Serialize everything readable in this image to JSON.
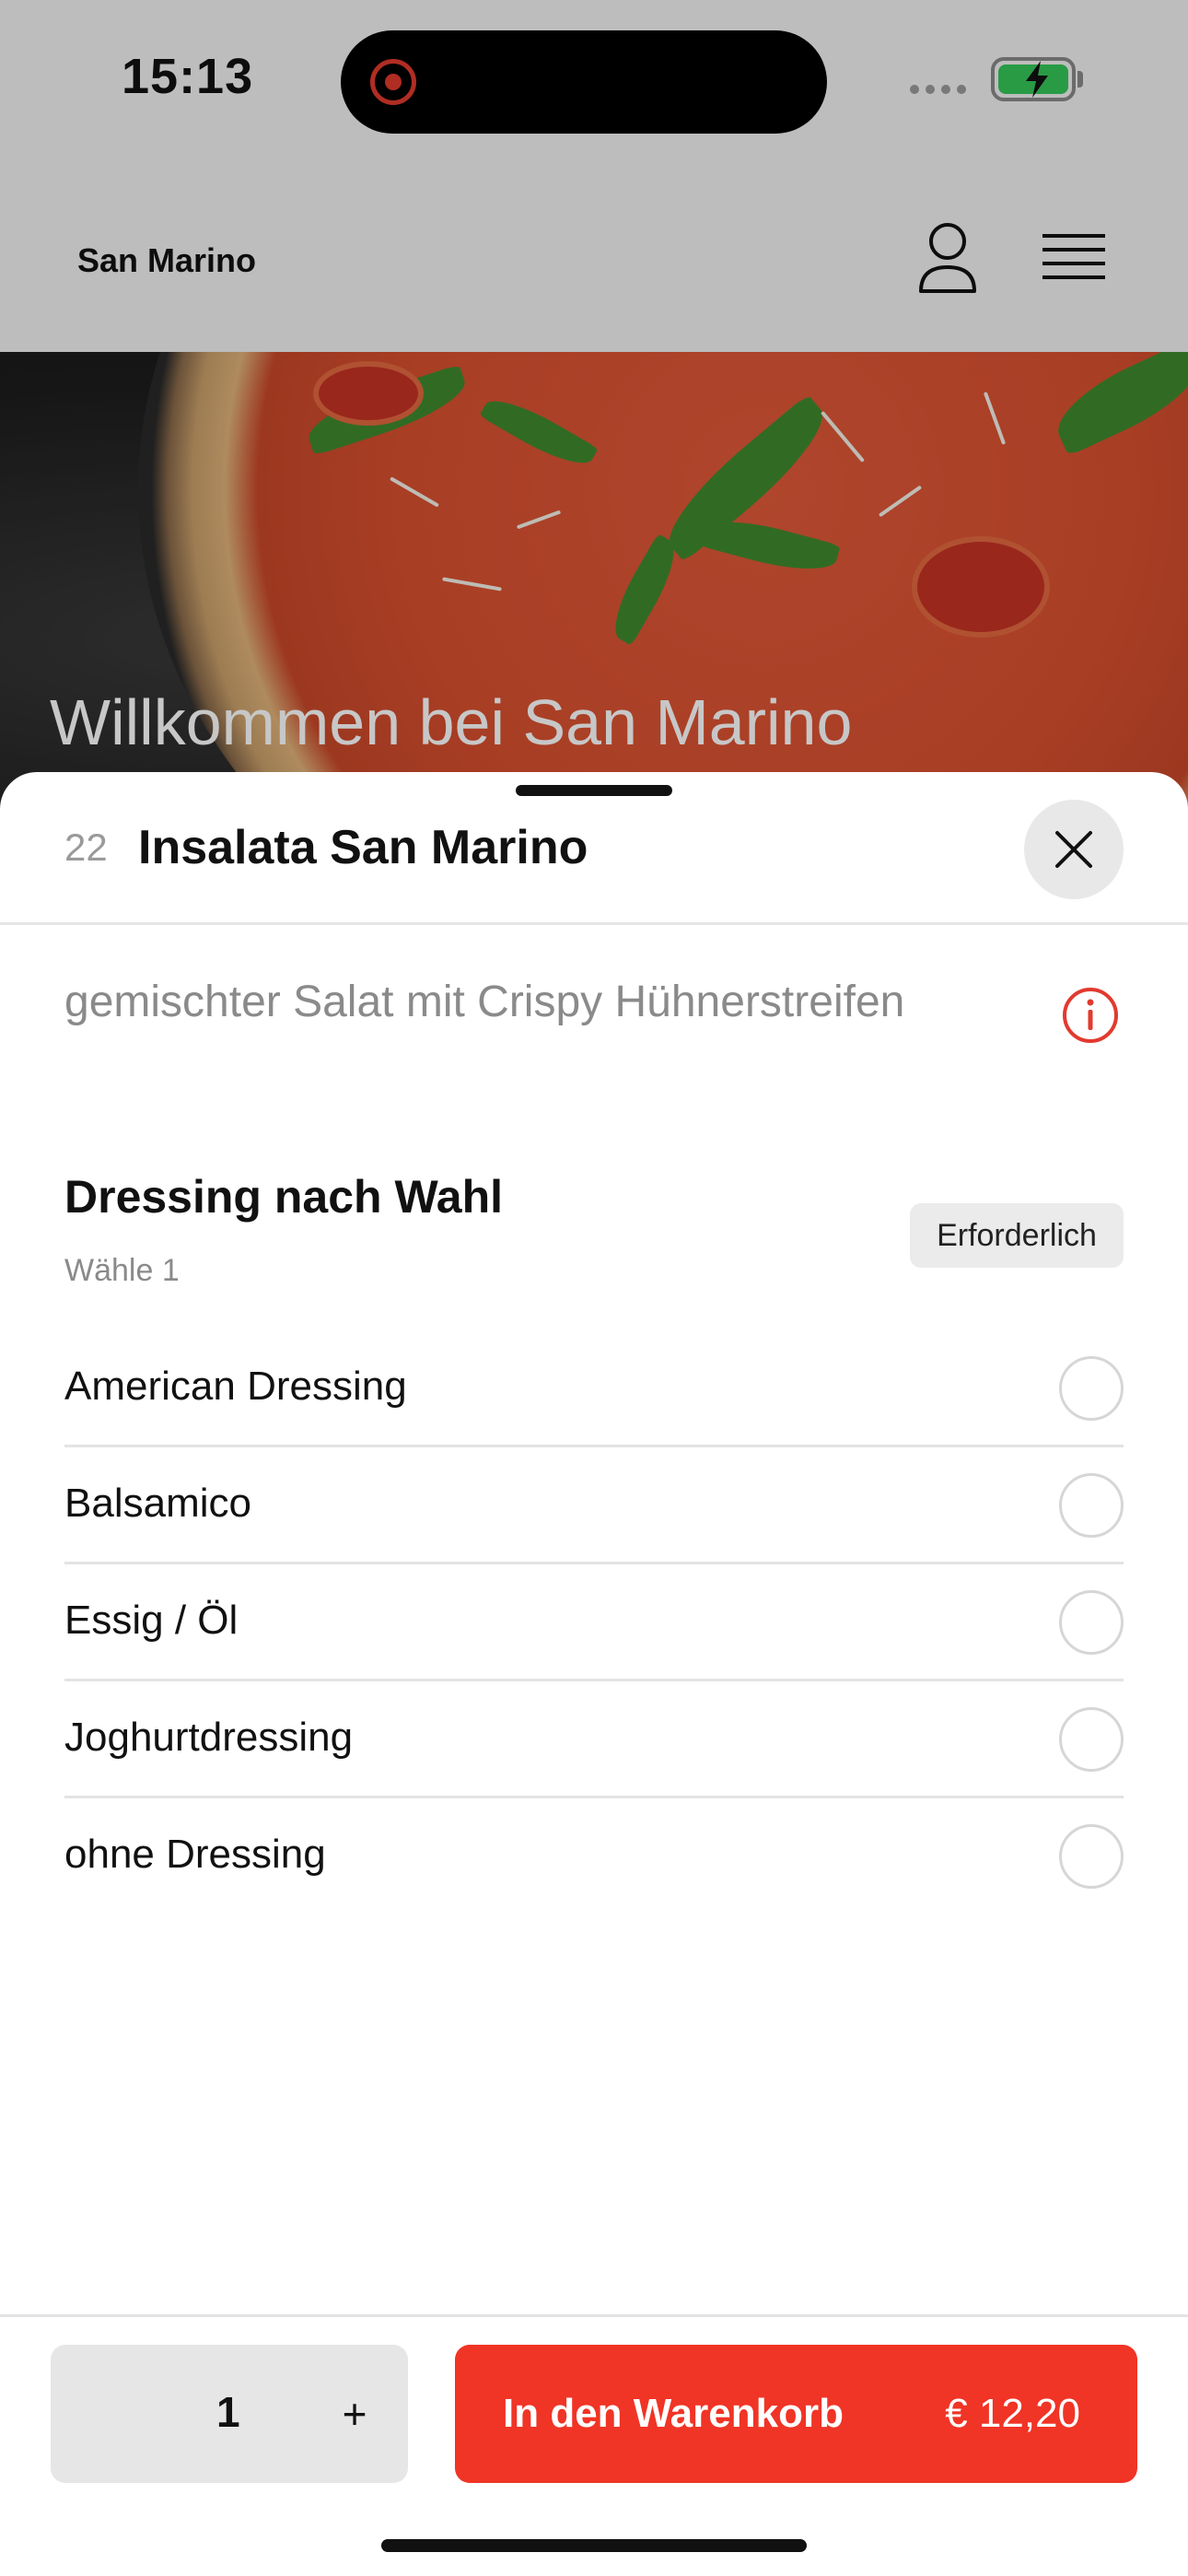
{
  "status_bar": {
    "time": "15:13"
  },
  "header": {
    "brand": "San Marino"
  },
  "hero": {
    "title": "Willkommen bei San Marino"
  },
  "item": {
    "number": "22",
    "title": "Insalata San Marino",
    "description": "gemischter Salat mit Crispy Hühnerstreifen"
  },
  "section": {
    "title": "Dressing nach Wahl",
    "subtitle": "Wähle 1",
    "badge": "Erforderlich",
    "options": [
      {
        "label": "American Dressing"
      },
      {
        "label": "Balsamico"
      },
      {
        "label": "Essig / Öl"
      },
      {
        "label": "Joghurtdressing"
      },
      {
        "label": "ohne Dressing"
      }
    ]
  },
  "footer": {
    "quantity": "1",
    "plus": "+",
    "cart_label": "In den Warenkorb",
    "price": "€ 12,20"
  },
  "colors": {
    "accent": "#f03425",
    "info_icon": "#e23a2e",
    "battery": "#35c759"
  },
  "icons": {
    "user": "user-icon",
    "menu": "menu-icon",
    "close": "close-icon",
    "info": "info-icon"
  }
}
